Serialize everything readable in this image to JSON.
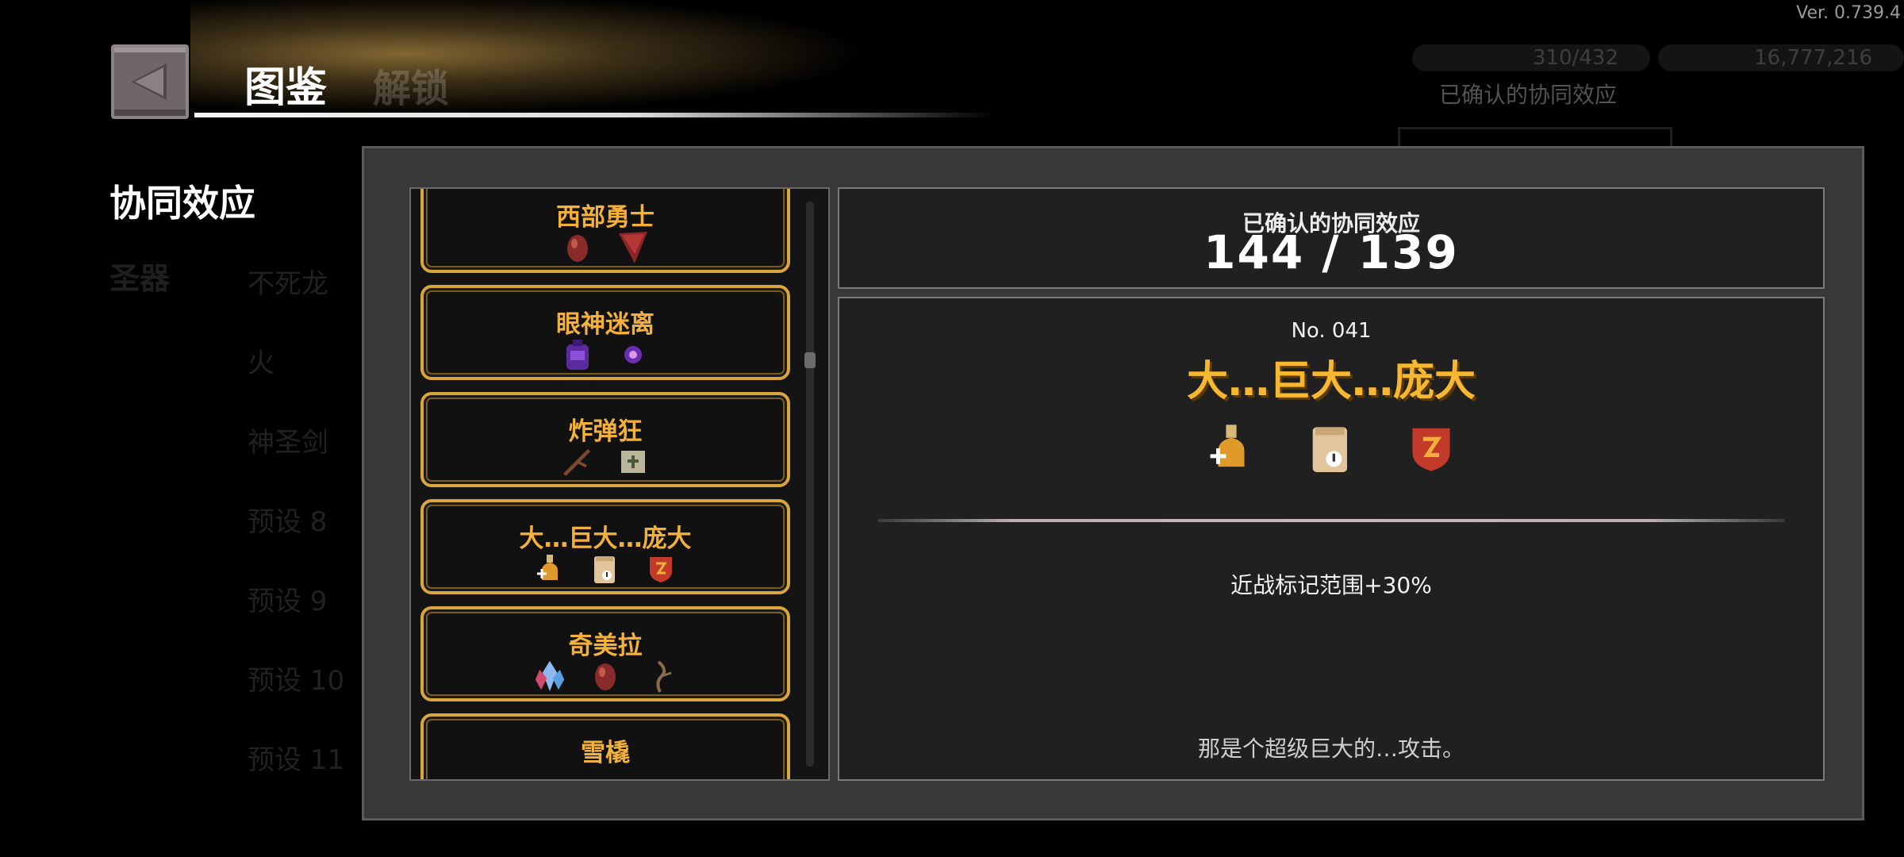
{
  "version": "Ver. 0.739.4",
  "header": {
    "title": "图鉴",
    "faded_tab": "解锁",
    "back_icon": "back-arrow-icon"
  },
  "sidebar": {
    "active": "协同效应",
    "faded": "圣器"
  },
  "background_list": [
    "不死龙",
    "火",
    "神圣剑",
    "预设 8",
    "预设 9",
    "预设 10",
    "预设 11"
  ],
  "background_counters": [
    "310/432",
    "16,777,216"
  ],
  "background_confirmed": "已确认的协同效应",
  "synergy_list": [
    {
      "name": "西部勇士",
      "icons": [
        "red-egg-icon",
        "red-bandana-icon"
      ]
    },
    {
      "name": "眼神迷离",
      "icons": [
        "purple-backpack-icon",
        "purple-orb-icon"
      ]
    },
    {
      "name": "炸弹狂",
      "icons": [
        "branch-icon",
        "scroll-icon"
      ]
    },
    {
      "name": "大…巨大…庞大",
      "icons": [
        "potion-icon",
        "paper-bag-icon",
        "red-shield-icon"
      ]
    },
    {
      "name": "奇美拉",
      "icons": [
        "crystal-icon",
        "red-egg-icon",
        "twig-icon"
      ]
    },
    {
      "name": "雪橇",
      "icons": []
    }
  ],
  "count": {
    "label": "已确认的协同效应",
    "value": "144 / 139"
  },
  "detail": {
    "number": "No. 041",
    "name": "大…巨大…庞大",
    "icons": [
      "potion-icon",
      "paper-bag-icon",
      "red-shield-icon"
    ],
    "effect": "近战标记范围+30%",
    "flavor": "那是个超级巨大的…攻击。"
  },
  "colors": {
    "gold_text": "#f3b03a",
    "card_border": "#d9a53f",
    "dialog_bg": "#383838"
  }
}
